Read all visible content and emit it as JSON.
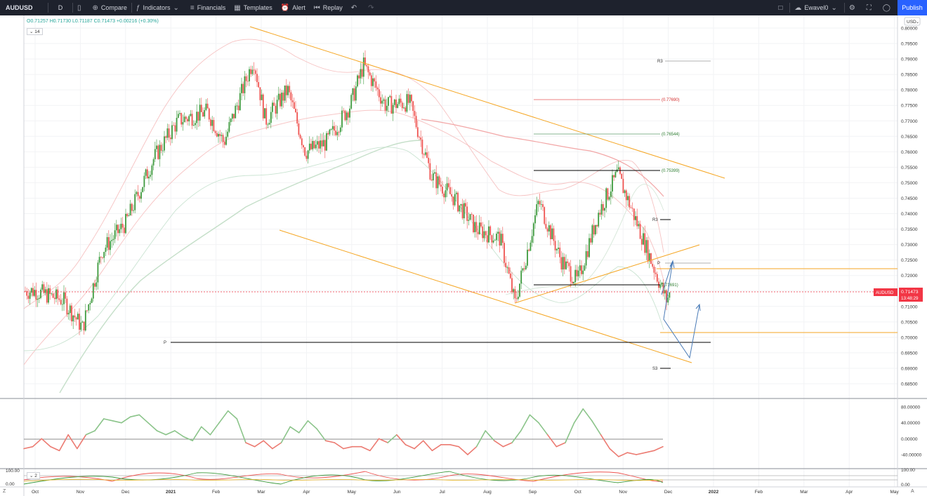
{
  "toolbar": {
    "symbol": "AUDUSD",
    "interval": "D",
    "compare": "Compare",
    "indicators": "Indicators",
    "financials": "Financials",
    "templates": "Templates",
    "alert": "Alert",
    "replay": "Replay",
    "username": "Ewavel0",
    "publish": "Publish"
  },
  "legend": {
    "ohlc": "O0.71257 H0.71730 L0.71187 C0.71473 +0.00216 (+0.30%)",
    "indicator_tag": "14",
    "indicator2_tag": "2"
  },
  "colors": {
    "up": "#26a69a",
    "up_bar": "#3d9a3d",
    "down": "#ef5350",
    "channel": "#f5a623",
    "projection": "#4a7bb7",
    "last_price_bg": "#f23645"
  },
  "price_axis": {
    "currency": "USD",
    "ticks": [
      "0.80000",
      "0.79500",
      "0.79000",
      "0.78500",
      "0.78000",
      "0.77500",
      "0.77000",
      "0.76500",
      "0.76000",
      "0.75500",
      "0.75000",
      "0.74500",
      "0.74000",
      "0.73500",
      "0.73000",
      "0.72500",
      "0.72000",
      "0.71500",
      "0.71000",
      "0.70500",
      "0.70000",
      "0.69500",
      "0.69000",
      "0.68500"
    ],
    "last_label": "AUDUSD",
    "last_price": "0.71473",
    "countdown": "13:48:29"
  },
  "osc_axis": {
    "ticks": [
      "80.00000",
      "40.00000",
      "0.00000",
      "-40.00000"
    ]
  },
  "osc2_axis": {
    "ticks": [
      "100.00",
      "0.00"
    ]
  },
  "time_axis": [
    "Oct",
    "Nov",
    "Dec",
    "2021",
    "Feb",
    "Mar",
    "Apr",
    "May",
    "Jun",
    "Jul",
    "Aug",
    "Sep",
    "Oct",
    "Nov",
    "Dec",
    "2022",
    "Feb",
    "Mar",
    "Apr",
    "May"
  ],
  "annotations": {
    "r3_top": "R3",
    "fib_77690": "(0.77690)",
    "fib_76544": "(0.76544)",
    "fib_75399": "(0.75399)",
    "r3": "R3",
    "p_right": "P",
    "fib_71691": "0.71691)",
    "p_left": "P",
    "s3": "S3"
  },
  "chart_data": {
    "type": "candlestick",
    "symbol": "AUDUSD",
    "interval": "D",
    "ylim": [
      0.684,
      0.801
    ],
    "x_range": [
      "2020-10",
      "2022-05"
    ],
    "close_path": [
      {
        "x": "2020-10-01",
        "y": 0.715
      },
      {
        "x": "2020-10-20",
        "y": 0.712
      },
      {
        "x": "2020-11-02",
        "y": 0.703
      },
      {
        "x": "2020-11-15",
        "y": 0.728
      },
      {
        "x": "2020-12-01",
        "y": 0.737
      },
      {
        "x": "2020-12-20",
        "y": 0.758
      },
      {
        "x": "2021-01-05",
        "y": 0.77
      },
      {
        "x": "2021-01-25",
        "y": 0.773
      },
      {
        "x": "2021-02-05",
        "y": 0.763
      },
      {
        "x": "2021-02-25",
        "y": 0.79
      },
      {
        "x": "2021-03-05",
        "y": 0.77
      },
      {
        "x": "2021-03-20",
        "y": 0.78
      },
      {
        "x": "2021-04-01",
        "y": 0.76
      },
      {
        "x": "2021-04-15",
        "y": 0.763
      },
      {
        "x": "2021-05-01",
        "y": 0.775
      },
      {
        "x": "2021-05-10",
        "y": 0.788
      },
      {
        "x": "2021-05-25",
        "y": 0.775
      },
      {
        "x": "2021-06-10",
        "y": 0.776
      },
      {
        "x": "2021-06-25",
        "y": 0.752
      },
      {
        "x": "2021-07-10",
        "y": 0.745
      },
      {
        "x": "2021-07-25",
        "y": 0.735
      },
      {
        "x": "2021-08-10",
        "y": 0.732
      },
      {
        "x": "2021-08-20",
        "y": 0.711
      },
      {
        "x": "2021-09-05",
        "y": 0.744
      },
      {
        "x": "2021-09-20",
        "y": 0.725
      },
      {
        "x": "2021-10-01",
        "y": 0.718
      },
      {
        "x": "2021-10-15",
        "y": 0.74
      },
      {
        "x": "2021-10-28",
        "y": 0.753
      },
      {
        "x": "2021-11-10",
        "y": 0.737
      },
      {
        "x": "2021-11-25",
        "y": 0.718
      },
      {
        "x": "2021-11-30",
        "y": 0.712
      },
      {
        "x": "2021-12-03",
        "y": 0.71473
      }
    ],
    "levels": [
      {
        "label": "R3",
        "value": 0.7895
      },
      {
        "label": "(0.77690)",
        "value": 0.7769
      },
      {
        "label": "(0.76544)",
        "value": 0.76544
      },
      {
        "label": "(0.75399)",
        "value": 0.75399
      },
      {
        "label": "R3",
        "value": 0.738
      },
      {
        "label": "P",
        "value": 0.724
      },
      {
        "label": "0.71691)",
        "value": 0.71691
      },
      {
        "label": "P",
        "value": 0.6985
      },
      {
        "label": "S3",
        "value": 0.69
      }
    ],
    "last_price": 0.71473,
    "oscillator": {
      "ylim": [
        -60,
        90
      ],
      "zero_line": 0,
      "values": [
        -25,
        -20,
        0,
        -20,
        -30,
        10,
        -25,
        10,
        20,
        50,
        45,
        40,
        55,
        60,
        40,
        20,
        10,
        20,
        5,
        -5,
        30,
        10,
        40,
        70,
        50,
        -10,
        -20,
        -5,
        -25,
        -10,
        30,
        15,
        45,
        25,
        -5,
        -10,
        -25,
        -20,
        -20,
        -30,
        0,
        -10,
        10,
        -15,
        -25,
        -5,
        -30,
        -15,
        -15,
        -20,
        -40,
        -20,
        20,
        -5,
        -20,
        -10,
        20,
        60,
        40,
        10,
        -20,
        -10,
        40,
        75,
        45,
        10,
        -25,
        -45,
        -35,
        -40,
        -35,
        -30,
        -20
      ]
    },
    "xlabel": "",
    "ylabel": ""
  }
}
